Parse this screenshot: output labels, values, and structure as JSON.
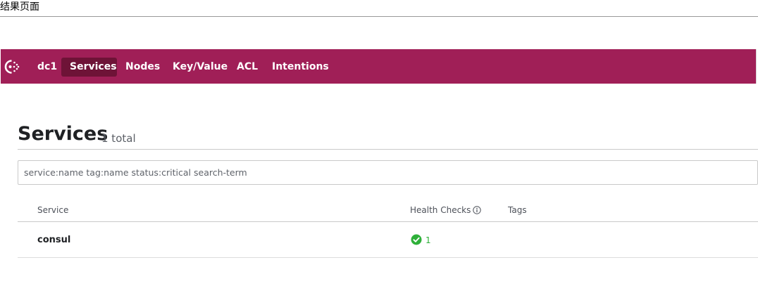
{
  "caption": "结果页面",
  "navbar": {
    "items": [
      {
        "label": "dc1"
      },
      {
        "label": "Services"
      },
      {
        "label": "Nodes"
      },
      {
        "label": "Key/Value"
      },
      {
        "label": "ACL"
      },
      {
        "label": "Intentions"
      }
    ],
    "active": "Services",
    "background_color": "#a01f57",
    "active_color": "#6e1337"
  },
  "page": {
    "title": "Services",
    "count": "1 total"
  },
  "search": {
    "placeholder": "service:name tag:name status:critical search-term",
    "value": ""
  },
  "table": {
    "columns": [
      "Service",
      "Health Checks",
      "Tags"
    ],
    "rows": [
      {
        "service": "consul",
        "health_passing": "1",
        "tags": ""
      }
    ]
  },
  "colors": {
    "passing": "#2eb039"
  },
  "icons": {
    "logo": "consul-logo-icon",
    "info": "info-icon",
    "passing": "check-circle-icon"
  }
}
